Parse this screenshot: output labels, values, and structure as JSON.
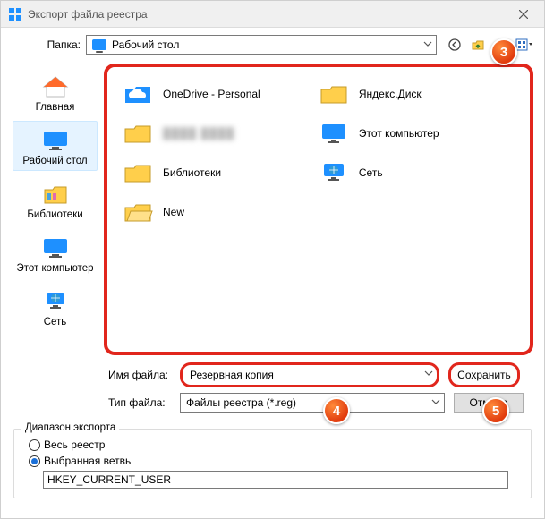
{
  "window": {
    "title": "Экспорт файла реестра",
    "close_tooltip": "Close"
  },
  "folder_row": {
    "label": "Папка:",
    "current": "Рабочий стол",
    "icons": {
      "back": "back-icon",
      "up": "up-folder-icon",
      "newfolder": "new-folder-icon",
      "views": "views-icon"
    }
  },
  "sidebar": {
    "items": [
      {
        "key": "home",
        "label": "Главная",
        "icon": "home-icon",
        "selected": false
      },
      {
        "key": "desktop",
        "label": "Рабочий стол",
        "icon": "desktop-icon",
        "selected": true
      },
      {
        "key": "libraries",
        "label": "Библиотеки",
        "icon": "libraries-icon",
        "selected": false
      },
      {
        "key": "thispc",
        "label": "Этот компьютер",
        "icon": "monitor-icon",
        "selected": false
      },
      {
        "key": "network",
        "label": "Сеть",
        "icon": "network-icon",
        "selected": false
      }
    ]
  },
  "listing": {
    "items": [
      {
        "label": "OneDrive - Personal",
        "icon": "onedrive-icon"
      },
      {
        "label": "Яндекс.Диск",
        "icon": "folder-icon"
      },
      {
        "label": "(скрыто)",
        "icon": "folder-icon",
        "blurred": true
      },
      {
        "label": "Этот компьютер",
        "icon": "monitor-icon"
      },
      {
        "label": "Библиотеки",
        "icon": "folder-icon"
      },
      {
        "label": "Сеть",
        "icon": "network-icon"
      },
      {
        "label": "New",
        "icon": "folder-open-icon"
      }
    ]
  },
  "form": {
    "filename_label": "Имя файла:",
    "filename_value": "Резервная копия",
    "filetype_label": "Тип файла:",
    "filetype_value": "Файлы реестра (*.reg)",
    "save_label": "Сохранить",
    "cancel_label": "Отмена"
  },
  "range": {
    "legend": "Диапазон экспорта",
    "all_label": "Весь реестр",
    "branch_label": "Выбранная ветвь",
    "branch_selected": true,
    "branch_value": "HKEY_CURRENT_USER"
  },
  "callouts": {
    "c3": "3",
    "c4": "4",
    "c5": "5"
  },
  "colors": {
    "highlight": "#e1261c"
  }
}
